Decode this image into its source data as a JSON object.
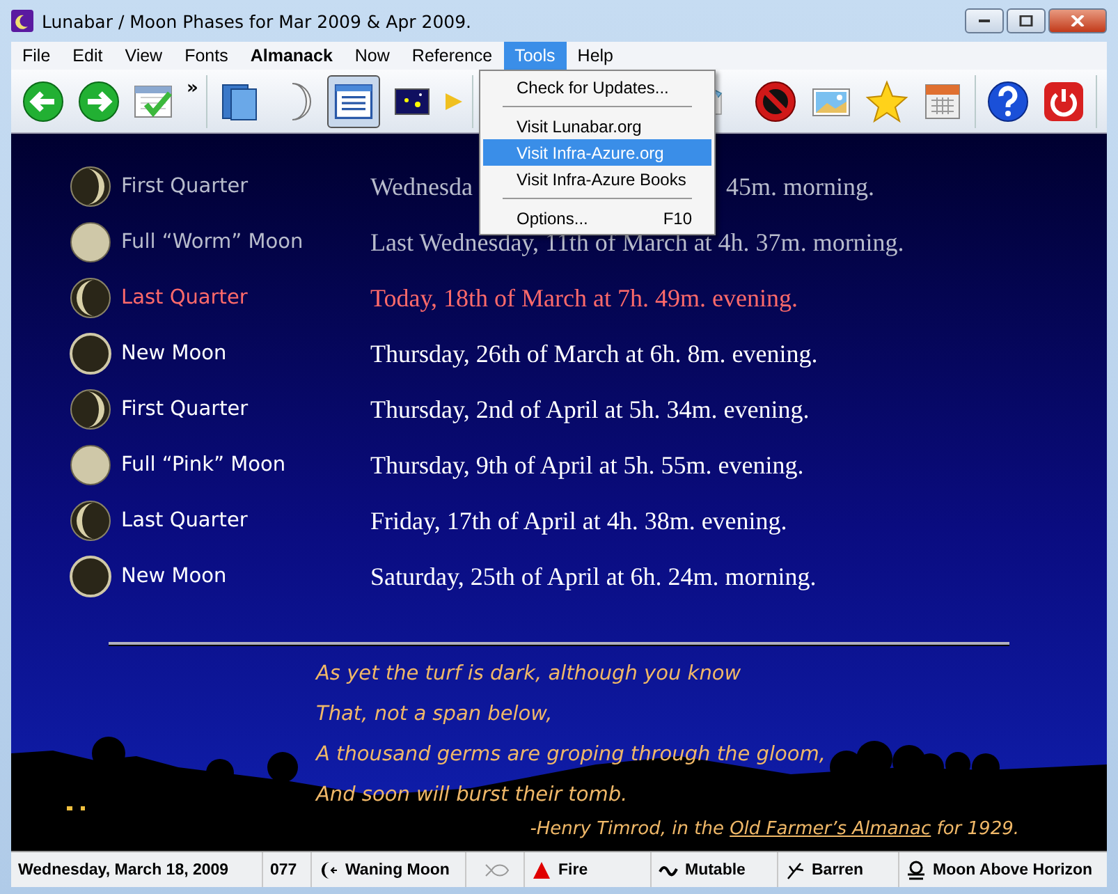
{
  "window": {
    "title": "Lunabar / Moon Phases for Mar 2009 & Apr 2009."
  },
  "menu_bar": [
    {
      "label": "File",
      "selected": false,
      "bold": false
    },
    {
      "label": "Edit",
      "selected": false,
      "bold": false
    },
    {
      "label": "View",
      "selected": false,
      "bold": false
    },
    {
      "label": "Fonts",
      "selected": false,
      "bold": false
    },
    {
      "label": "Almanack",
      "selected": false,
      "bold": true
    },
    {
      "label": "Now",
      "selected": false,
      "bold": false
    },
    {
      "label": "Reference",
      "selected": false,
      "bold": false
    },
    {
      "label": "Tools",
      "selected": true,
      "bold": false
    },
    {
      "label": "Help",
      "selected": false,
      "bold": false
    }
  ],
  "toolbar": {
    "overflow": "»",
    "list_view_pressed": true
  },
  "tools_menu": [
    {
      "kind": "item",
      "label": "Check for Updates...",
      "selected": false
    },
    {
      "kind": "separator"
    },
    {
      "kind": "item",
      "label": "Visit Lunabar.org",
      "selected": false
    },
    {
      "kind": "item",
      "label": "Visit Infra-Azure.org",
      "selected": true
    },
    {
      "kind": "item",
      "label": "Visit Infra-Azure Books",
      "selected": false
    },
    {
      "kind": "separator"
    },
    {
      "kind": "item",
      "label": "Options...",
      "shortcut": "F10",
      "selected": false
    }
  ],
  "phases": [
    {
      "kind": "first_quarter",
      "name": "First Quarter",
      "date": "Wednesda",
      "date_tail": "45m. morning.",
      "past": true,
      "today": false
    },
    {
      "kind": "full",
      "name": "Full “Worm” Moon",
      "date": "Last Wednesday, 11th of March at 4h. 37m. morning.",
      "past": true,
      "today": false
    },
    {
      "kind": "last_quarter",
      "name": "Last Quarter",
      "date": "Today, 18th of March at 7h. 49m. evening.",
      "past": false,
      "today": true
    },
    {
      "kind": "new",
      "name": "New Moon",
      "date": "Thursday, 26th of March at 6h. 8m. evening.",
      "past": false,
      "today": false
    },
    {
      "kind": "first_quarter",
      "name": "First Quarter",
      "date": "Thursday, 2nd of April at 5h. 34m. evening.",
      "past": false,
      "today": false
    },
    {
      "kind": "full",
      "name": "Full “Pink” Moon",
      "date": "Thursday, 9th of April at 5h. 55m. evening.",
      "past": false,
      "today": false
    },
    {
      "kind": "last_quarter",
      "name": "Last Quarter",
      "date": "Friday, 17th of April at 4h. 38m. evening.",
      "past": false,
      "today": false
    },
    {
      "kind": "new",
      "name": "New Moon",
      "date": "Saturday, 25th of April at 6h. 24m. morning.",
      "past": false,
      "today": false
    }
  ],
  "poem": {
    "lines": [
      "As yet the turf is dark, although you know",
      "That, not a span below,",
      "A thousand germs are groping through the gloom,",
      "And soon will burst their tomb."
    ],
    "attribution_before": "-Henry Timrod, in the",
    "link": "Old Farmer’s Almanac",
    "attribution_after": "for 1929."
  },
  "status_bar": [
    {
      "kind": "date",
      "text": "Wednesday, March 18, 2009"
    },
    {
      "kind": "plain",
      "text": "077"
    },
    {
      "kind": "waning",
      "text": "Waning Moon"
    },
    {
      "kind": "fish"
    },
    {
      "kind": "fire",
      "text": "Fire"
    },
    {
      "kind": "wave",
      "text": "Mutable"
    },
    {
      "kind": "barren",
      "text": "Barren"
    },
    {
      "kind": "horizon",
      "text": "Moon Above Horizon"
    }
  ]
}
